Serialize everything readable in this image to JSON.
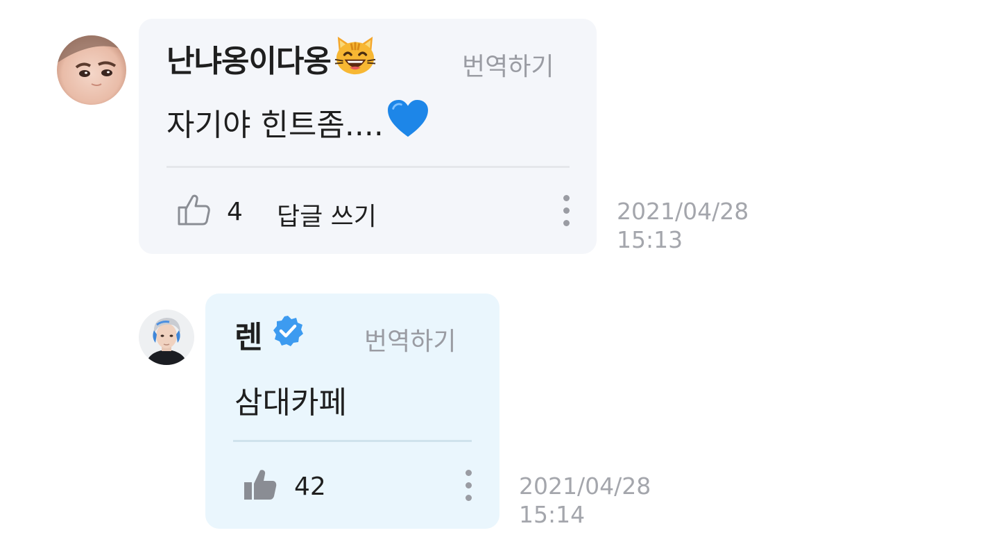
{
  "comments": [
    {
      "author": "난냐옹이다옹",
      "author_icon": "cat-face-emoji",
      "translate_label": "번역하기",
      "text": "자기야 힌트좀....",
      "text_icon": "blue-heart-emoji",
      "likes": "4",
      "reply_label": "답글 쓰기",
      "date": "2021/04/28",
      "time": "15:13"
    }
  ],
  "replies": [
    {
      "author": "렌",
      "author_icon": "verified-badge",
      "translate_label": "번역하기",
      "text": "삼대카페",
      "likes": "42",
      "date": "2021/04/28",
      "time": "15:14"
    }
  ],
  "colors": {
    "comment_bg": "#f4f6fa",
    "reply_bg": "#eaf6fd",
    "verified_blue": "#3d9bf0",
    "muted_text": "#9a9ca3"
  }
}
